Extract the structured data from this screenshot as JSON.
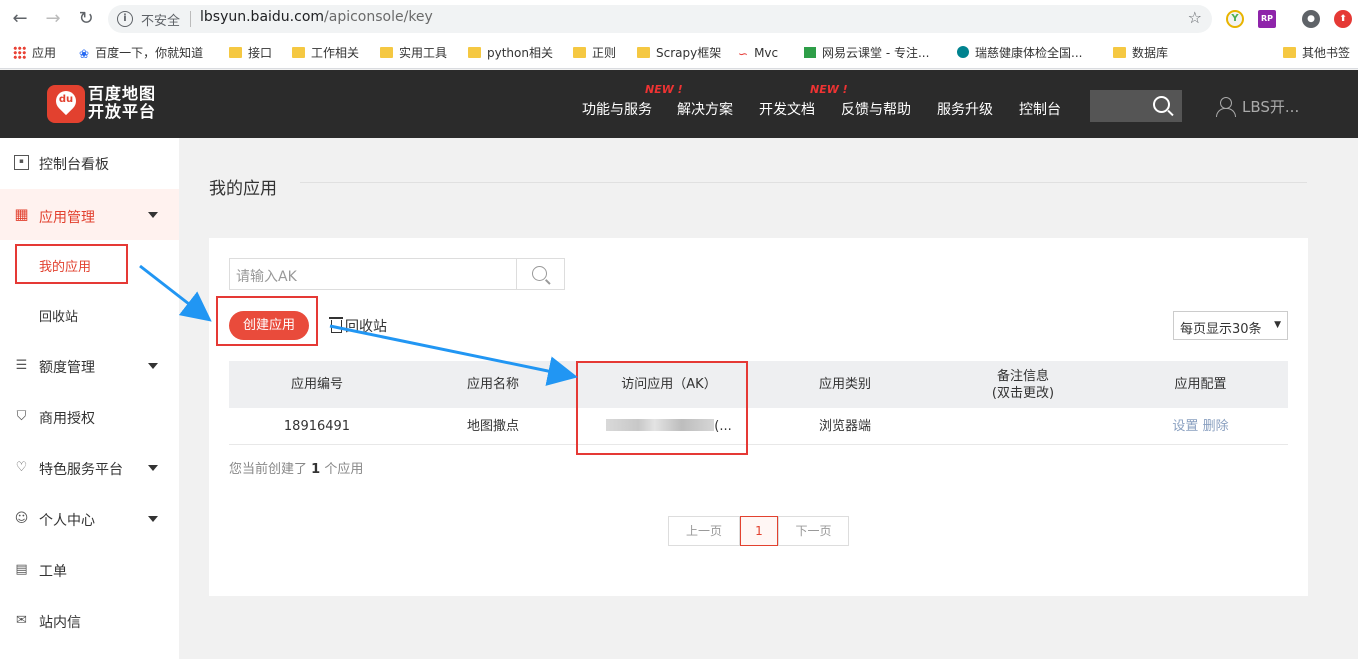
{
  "browser": {
    "security_label": "不安全",
    "url_host": "lbsyun.baidu.com",
    "url_path": "/apiconsole/key",
    "bookmarks": [
      "应用",
      "百度一下，你就知道",
      "接口",
      "工作相关",
      "实用工具",
      "python相关",
      "正则",
      "Scrapy框架",
      "Mvc",
      "网易云课堂 - 专注...",
      "瑞慈健康体检全国...",
      "数据库",
      "其他书签"
    ]
  },
  "header": {
    "logo_line1": "百度地图",
    "logo_line2": "开放平台",
    "logo_mark": "du",
    "nav": [
      "功能与服务",
      "解决方案",
      "开发文档",
      "反馈与帮助",
      "服务升级",
      "控制台"
    ],
    "new_badge": "NEW !",
    "user": "LBS开..."
  },
  "sidebar": {
    "items": [
      "控制台看板",
      "应用管理",
      "额度管理",
      "商用授权",
      "特色服务平台",
      "个人中心",
      "工单",
      "站内信"
    ],
    "sub_items": [
      "我的应用",
      "回收站"
    ]
  },
  "main": {
    "title": "我的应用",
    "search_placeholder": "请输入AK",
    "create_label": "创建应用",
    "recycle_label": "回收站",
    "per_page": "每页显示30条",
    "columns": [
      "应用编号",
      "应用名称",
      "访问应用（AK）",
      "应用类别",
      "备注信息\n(双击更改)",
      "应用配置"
    ],
    "rows": [
      {
        "id": "18916491",
        "name": "地图撒点",
        "ak_suffix": "(...",
        "category": "浏览器端",
        "note": "",
        "config_set": "设置",
        "config_delete": "删除"
      }
    ],
    "summary_prefix": "您当前创建了",
    "summary_count": "1",
    "summary_suffix": "个应用",
    "pager": {
      "prev": "上一页",
      "current": "1",
      "next": "下一页"
    }
  },
  "colors": {
    "accent": "#e2412f",
    "annotation": "#e53935",
    "arrow": "#2196f3"
  }
}
